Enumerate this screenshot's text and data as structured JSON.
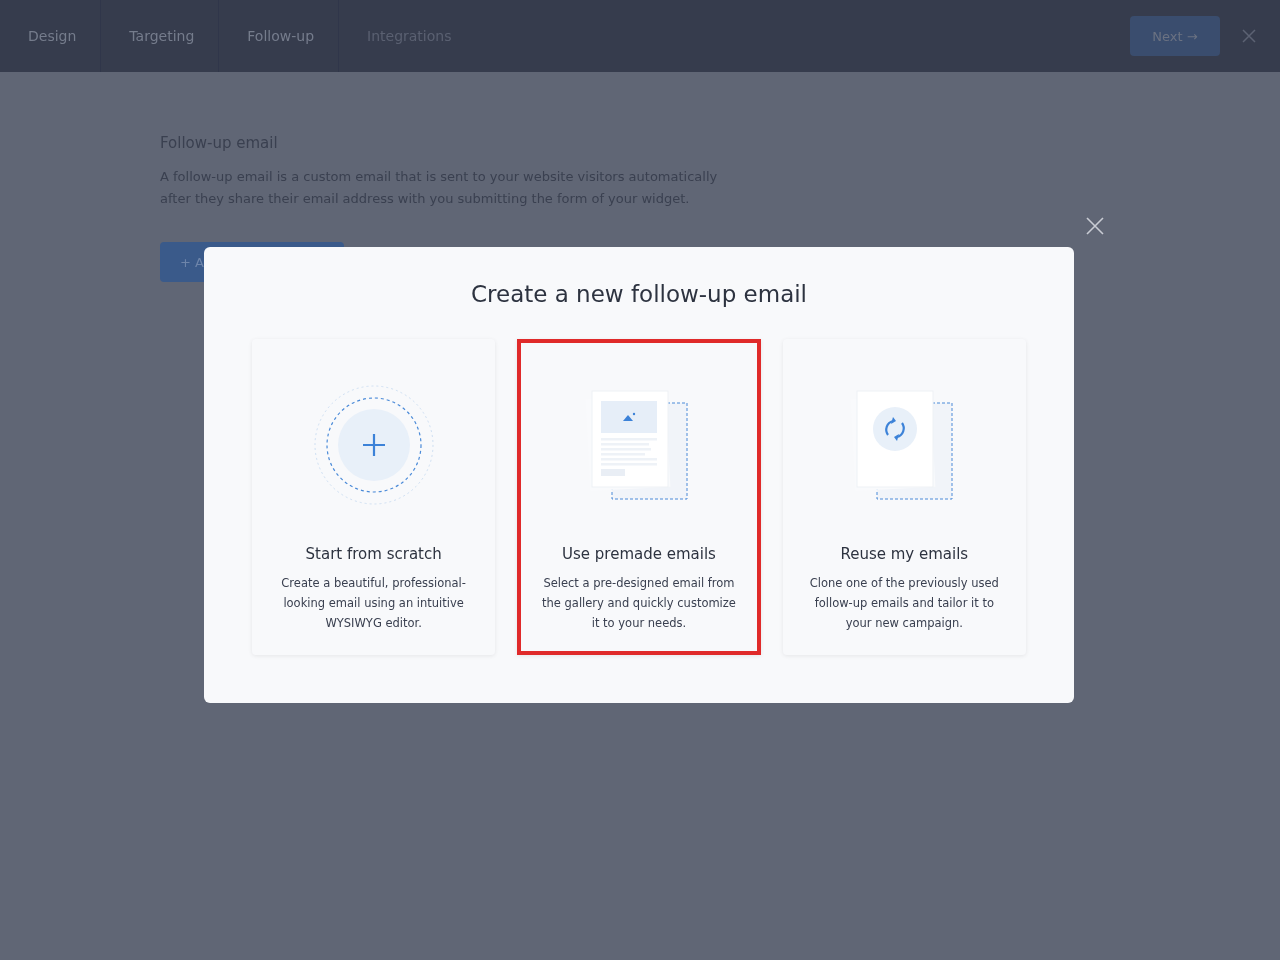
{
  "steps": [
    {
      "label": "Design",
      "reached": true
    },
    {
      "label": "Targeting",
      "reached": true
    },
    {
      "label": "Follow-up",
      "reached": true
    },
    {
      "label": "Integrations",
      "reached": false
    }
  ],
  "next_button": {
    "label": "Next →"
  },
  "section": {
    "title": "Follow-up email",
    "description": "A follow-up email is a custom email that is sent to your website visitors automatically after they share their email address with you submitting the form of your widget.",
    "add_button": "+ A"
  },
  "modal": {
    "title": "Create a new follow-up email",
    "options": [
      {
        "kind": "scratch",
        "title": "Start from scratch",
        "description": "Create a beautiful, professional-looking email using an intuitive WYSIWYG editor.",
        "selected": false
      },
      {
        "kind": "premade",
        "title": "Use premade emails",
        "description": "Select a pre-designed email from the gallery and quickly customize it to your needs.",
        "selected": true
      },
      {
        "kind": "reuse",
        "title": "Reuse my emails",
        "description": "Clone one of the previously used follow-up emails and tailor it to your new campaign.",
        "selected": false
      }
    ]
  }
}
